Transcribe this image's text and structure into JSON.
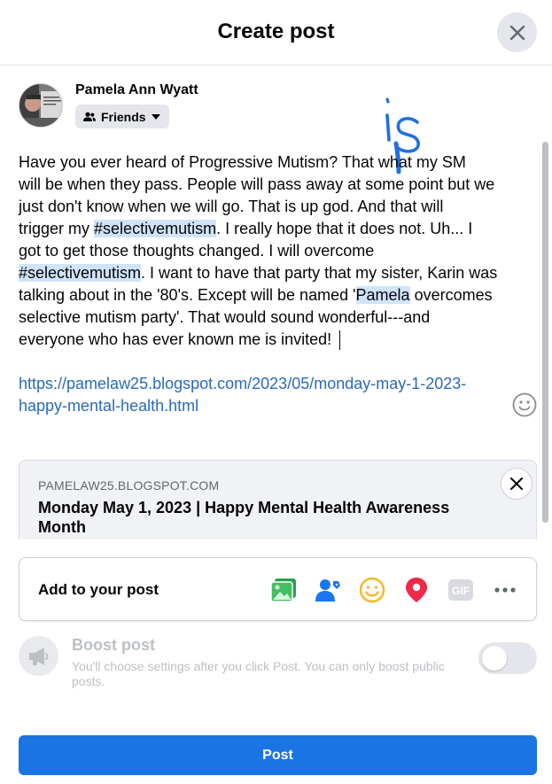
{
  "dialog": {
    "title": "Create post"
  },
  "user": {
    "name": "Pamela Ann Wyatt",
    "audience": "Friends",
    "avatar_text": "It costs nothing to be nice."
  },
  "handwritten_annotation": "is",
  "post": {
    "line1a": "Have you ever heard of Progressive Mutism?  That ",
    "line1b": " what my SM",
    "line2": "will be when they pass. People will pass away at some point but we",
    "line3": "just don't know when we will go. That is up god.  And that will",
    "line4a": "trigger my ",
    "hashtag1": "#selectivemutism",
    "line4b": ".  I really hope that it does not.  Uh... I",
    "line5": "got to get those thoughts changed. I will overcome",
    "hashtag2": "#selectivemutism",
    "line6b": ". I want to have that party that my sister, Karin was",
    "line7a": "talking about in the '80's.  Except will be named '",
    "name_highlight": "Pamela",
    "line7b": " overcomes",
    "line8": "selective mutism party'.  That would sound wonderful---and",
    "line9": "everyone who has ever known me is invited! "
  },
  "link": {
    "line1": "https://pamelaw25.blogspot.com/2023/05/monday-may-1-2023-",
    "line2": "happy-mental-health.html"
  },
  "link_preview": {
    "domain": "PAMELAW25.BLOGSPOT.COM",
    "title": "Monday May 1, 2023 | Happy Mental Health Awareness Month"
  },
  "add_to_post": {
    "label": "Add to your post",
    "icons": [
      "photo-video-icon",
      "tag-people-icon",
      "feeling-activity-icon",
      "check-in-icon",
      "gif-icon",
      "more-options-icon"
    ]
  },
  "boost": {
    "title": "Boost post",
    "description": "You'll choose settings after you click Post. You can only boost public posts.",
    "enabled": false
  },
  "post_button": {
    "label": "Post"
  },
  "colors": {
    "primary": "#1b74e4",
    "link": "#2a6ab9",
    "highlight": "#cfe4fa",
    "disabled_text": "#bcc0c4"
  }
}
